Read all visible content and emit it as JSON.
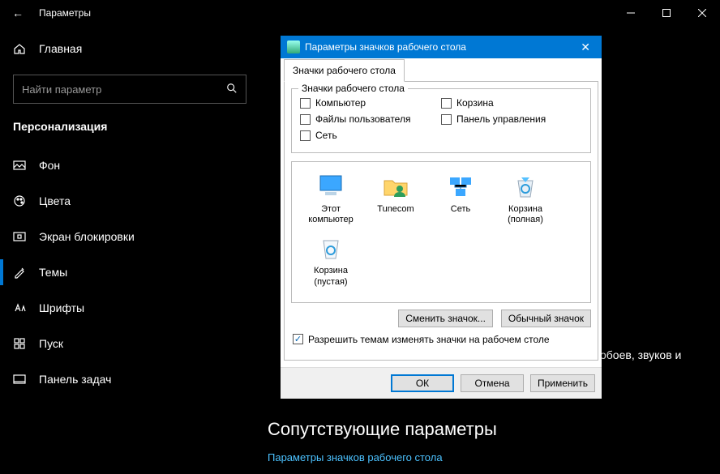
{
  "titlebar": {
    "back_icon": "←",
    "title": "Параметры"
  },
  "sidebar": {
    "home": "Главная",
    "search_placeholder": "Найти параметр",
    "section": "Персонализация",
    "items": [
      {
        "label": "Фон"
      },
      {
        "label": "Цвета"
      },
      {
        "label": "Экран блокировки"
      },
      {
        "label": "Темы"
      },
      {
        "label": "Шрифты"
      },
      {
        "label": "Пуск"
      },
      {
        "label": "Панель задач"
      }
    ]
  },
  "main": {
    "truncated_text": "обоев, звуков и",
    "related_title": "Сопутствующие параметры",
    "related_link": "Параметры значков рабочего стола"
  },
  "dialog": {
    "title": "Параметры значков рабочего стола",
    "tab": "Значки рабочего стола",
    "group_title": "Значки рабочего стола",
    "checks_left": [
      "Компьютер",
      "Файлы пользователя",
      "Сеть"
    ],
    "checks_right": [
      "Корзина",
      "Панель управления"
    ],
    "icons": [
      {
        "name": "Этот компьютер",
        "line2": ""
      },
      {
        "name": "Tunecom",
        "line2": ""
      },
      {
        "name": "Сеть",
        "line2": ""
      },
      {
        "name": "Корзина",
        "line2": "(полная)"
      },
      {
        "name": "Корзина",
        "line2": "(пустая)"
      }
    ],
    "change_btn": "Сменить значок...",
    "default_btn": "Обычный значок",
    "allow_text": "Разрешить темам изменять значки на рабочем столе",
    "ok": "ОК",
    "cancel": "Отмена",
    "apply": "Применить"
  }
}
